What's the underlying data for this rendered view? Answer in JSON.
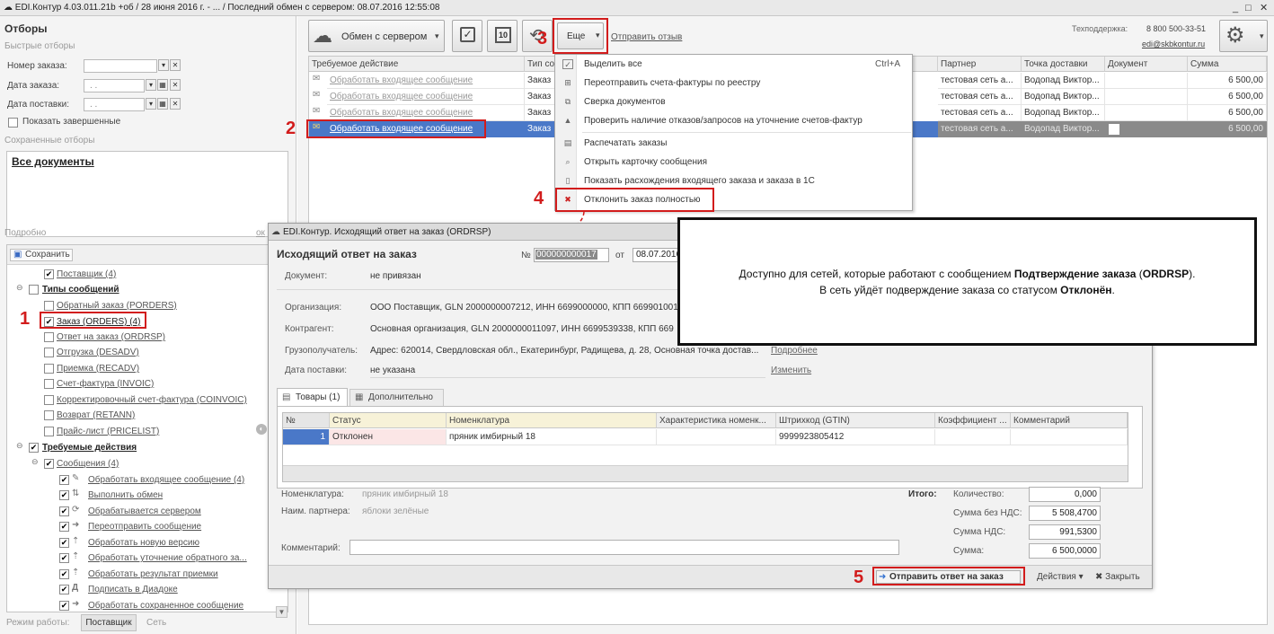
{
  "titlebar": {
    "title": "EDI.Контур 4.03.011.21b +об / 28 июня 2016 г. - ... / Последний обмен с сервером: 08.07.2016 12:55:08",
    "controls": [
      "_",
      "□",
      "✕"
    ]
  },
  "filters": {
    "title": "Отборы",
    "quick_title": "Быстрые отборы",
    "order_number_label": "Номер заказа:",
    "order_date_label": "Дата заказа:",
    "delivery_date_label": "Дата поставки:",
    "date_placeholder": ". .",
    "show_completed": "Показать завершенные",
    "saved_title": "Сохраненные отборы",
    "saved_item": "Все документы",
    "details_title": "Подробно",
    "details_link": "ок",
    "save_button": "Сохранить",
    "tree": {
      "supplier": "Поставщик (4)",
      "msg_types": "Типы сообщений",
      "porders": "Обратный заказ (PORDERS)",
      "orders": "Заказ (ORDERS) (4)",
      "ordrsp": "Ответ на заказ (ORDRSP)",
      "desadv": "Отгрузка (DESADV)",
      "recadv": "Приемка (RECADV)",
      "invoic": "Счет-фактура (INVOIC)",
      "coinvoic": "Корректировочный счет-фактура (COINVOIC)",
      "retann": "Возврат (RETANN)",
      "pricelist": "Прайс-лист (PRICELIST)",
      "required_actions": "Требуемые действия",
      "messages": "Сообщения (4)",
      "actions": [
        "Обработать входящее сообщение (4)",
        "Выполнить обмен",
        "Обрабатывается сервером",
        "Переотправить сообщение",
        "Обработать новую версию",
        "Обработать уточнение обратного за...",
        "Обработать результат приемки",
        "Подписать в Диадоке",
        "Обработать сохраненное сообщение"
      ]
    },
    "mode_label": "Режим работы:",
    "mode_supplier": "Поставщик",
    "mode_network": "Сеть"
  },
  "toolbar": {
    "exchange_button": "Обмен с сервером",
    "more_button": "Еще",
    "feedback_link": "Отправить отзыв",
    "support_label": "Техподдержка:",
    "support_phone": "8 800 500-33-51",
    "support_email": "edi@skbkontur.ru"
  },
  "grid": {
    "headers": [
      "Требуемое действие",
      "Тип со",
      "",
      "Партнер",
      "Точка доставки",
      "Документ",
      "Сумма"
    ],
    "rows": [
      {
        "action": "Обработать входящее сообщение",
        "type": "Заказ",
        "partner": "тестовая сеть а...",
        "point": "Водопад Виктор...",
        "doc": "",
        "sum": "6 500,00"
      },
      {
        "action": "Обработать входящее сообщение",
        "type": "Заказ",
        "partner": "тестовая сеть а...",
        "point": "Водопад Виктор...",
        "doc": "",
        "sum": "6 500,00"
      },
      {
        "action": "Обработать входящее сообщение",
        "type": "Заказ",
        "partner": "тестовая сеть а...",
        "point": "Водопад Виктор...",
        "doc": "",
        "sum": "6 500,00"
      },
      {
        "action": "Обработать входящее сообщение",
        "type": "Заказ",
        "partner": "тестовая сеть а...",
        "point": "Водопад Виктор...",
        "doc": "",
        "sum": "6 500,00"
      }
    ]
  },
  "menu": {
    "items": [
      {
        "label": "Выделить все",
        "shortcut": "Ctrl+A",
        "icon": "select-all-icon"
      },
      {
        "label": "Переотправить счета-фактуры по реестру",
        "icon": "resend-icon"
      },
      {
        "label": "Сверка документов",
        "icon": "compare-icon"
      },
      {
        "label": "Проверить наличие отказов/запросов на уточнение счетов-фактур",
        "icon": "warning-icon"
      },
      {
        "label": "Распечатать заказы",
        "icon": "printer-icon"
      },
      {
        "label": "Открыть карточку сообщения",
        "icon": "search-icon"
      },
      {
        "label": "Показать расхождения входящего заказа и заказа в 1С",
        "icon": "document-icon"
      },
      {
        "label": "Отклонить заказ полностью",
        "icon": "reject-icon"
      }
    ]
  },
  "steps": [
    "1",
    "2",
    "3",
    "4",
    "5"
  ],
  "dialog": {
    "window_title": "EDI.Контур. Исходящий ответ на заказ (ORDRSP)",
    "heading": "Исходящий ответ на заказ",
    "number_label": "№",
    "number_value": "000000000017",
    "date_from": "от",
    "date_value": "08.07.2016",
    "doc_label": "Документ:",
    "doc_value": "не привязан",
    "org_label": "Организация:",
    "org_value": "ООО Поставщик, GLN 2000000007212, ИНН 6699000000, КПП 669901001",
    "contractor_label": "Контрагент:",
    "contractor_value": "Основная организация, GLN 2000000011097, ИНН 6699539338, КПП 669",
    "consignee_label": "Грузополучатель:",
    "consignee_value": "Адрес: 620014, Свердловская обл., Екатеринбург, Радищева, д. 28, Основная точка достав...",
    "consignee_link": "Подробнее",
    "delivery_label": "Дата поставки:",
    "delivery_value": "не указана",
    "change_link": "Изменить",
    "tabs": [
      "Товары (1)",
      "Дополнительно"
    ],
    "table_headers": [
      "№",
      "Статус",
      "Номенклатура",
      "Характеристика номенк...",
      "Штрихкод (GTIN)",
      "Коэффициент ...",
      "Комментарий"
    ],
    "table_rows": [
      {
        "n": "1",
        "status": "Отклонен",
        "nom": "пряник имбирный 18",
        "char": "",
        "gtin": "9999923805412",
        "coef": "",
        "comment": ""
      }
    ],
    "nom_label": "Номенклатура:",
    "nom_value": "пряник имбирный 18",
    "partner_name_label": "Наим. партнера:",
    "partner_name_value": "яблоки зелёные",
    "comment_label": "Комментарий:",
    "totals_label": "Итого:",
    "qty_label": "Количество:",
    "qty_value": "0,000",
    "sum_novat_label": "Сумма без НДС:",
    "sum_novat_value": "5 508,4700",
    "vat_label": "Сумма НДС:",
    "vat_value": "991,5300",
    "sum_label": "Сумма:",
    "sum_value": "6 500,0000",
    "send_button": "Отправить ответ на заказ",
    "actions_button": "Действия",
    "close_button": "Закрыть"
  },
  "callout": {
    "line1_a": "Доступно для сетей, которые работают с сообщением ",
    "line1_b": "Подтверждение заказа",
    "line1_c": " (",
    "line1_d": "ORDRSP",
    "line1_e": ").",
    "line2_a": "В сеть уйдёт подверждение заказа со статусом ",
    "line2_b": "Отклонён",
    "line2_c": "."
  }
}
